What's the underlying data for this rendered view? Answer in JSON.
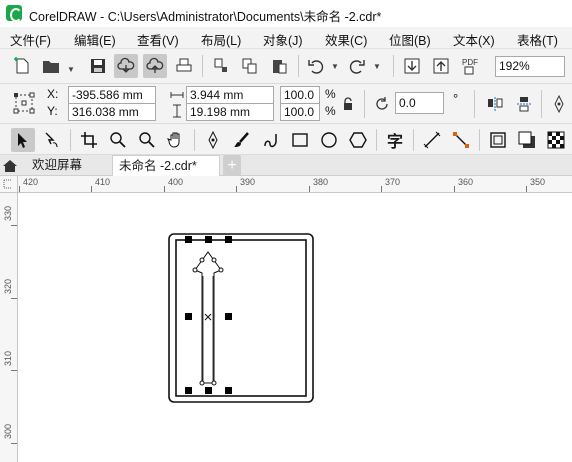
{
  "window": {
    "title": "CorelDRAW - C:\\Users\\Administrator\\Documents\\未命名 -2.cdr*"
  },
  "menu": [
    {
      "label": "文件(F)"
    },
    {
      "label": "编辑(E)"
    },
    {
      "label": "查看(V)"
    },
    {
      "label": "布局(L)"
    },
    {
      "label": "对象(J)"
    },
    {
      "label": "效果(C)"
    },
    {
      "label": "位图(B)"
    },
    {
      "label": "文本(X)"
    },
    {
      "label": "表格(T)"
    }
  ],
  "standard_toolbar": {
    "zoom_value": "192%",
    "icons": [
      "new-document-icon",
      "open-folder-icon",
      "save-icon",
      "cloud-download-icon",
      "cloud-upload-icon",
      "print-icon",
      "cut-icon",
      "copy-icon",
      "paste-icon",
      "undo-icon",
      "redo-icon",
      "import-icon",
      "export-icon",
      "publish-pdf-icon"
    ],
    "pdf_label": "PDF"
  },
  "property_bar": {
    "x_label": "X:",
    "x_value": "-395.586 mm",
    "y_label": "Y:",
    "y_value": "316.038 mm",
    "width_value": "3.944 mm",
    "height_value": "19.198 mm",
    "scale_x": "100.0",
    "scale_y": "100.0",
    "percent_symbol": "%",
    "rotation_value": "0.0",
    "degree_symbol": "°"
  },
  "toolbox": {
    "icons": [
      "pick-tool-icon",
      "shape-tool-icon",
      "crop-tool-icon",
      "zoom-tool-icon",
      "zoom-out-icon",
      "pan-tool-icon",
      "pen-tool-icon",
      "artistic-media-icon",
      "freehand-icon",
      "rectangle-tool-icon",
      "ellipse-tool-icon",
      "polygon-tool-icon",
      "text-tool-icon",
      "dimension-tool-icon",
      "connector-tool-icon",
      "shadow-tool-icon",
      "transparency-tool-icon",
      "pattern-fill-icon"
    ],
    "text_tool_glyph": "字"
  },
  "tabs": [
    {
      "label": "欢迎屏幕",
      "active": false
    },
    {
      "label": "未命名 -2.cdr*",
      "active": true
    }
  ],
  "ruler_h": {
    "labels": [
      "420",
      "410",
      "400",
      "390",
      "380",
      "370",
      "360",
      "350"
    ]
  },
  "ruler_v": {
    "labels": [
      "330",
      "320",
      "310",
      "300"
    ]
  },
  "colors": {
    "accent": "#1aa84a",
    "toolbar_bg": "#f3f3f3",
    "active_button": "#c9c9c9"
  }
}
